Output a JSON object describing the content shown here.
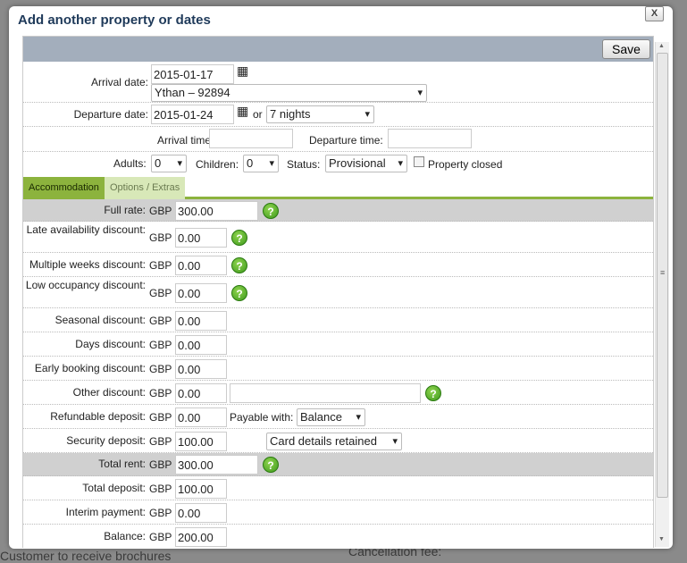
{
  "background": {
    "text1": "Customer to receive brochures",
    "text2": "Cancellation fee:"
  },
  "dialog": {
    "title": "Add another property or dates",
    "close_label": "X",
    "save_label": "Save"
  },
  "booking": {
    "arrival_date_label": "Arrival date:",
    "arrival_date": "2015-01-17",
    "property": "Ythan – 92894",
    "departure_date_label": "Departure date:",
    "departure_date": "2015-01-24",
    "or_label": "or",
    "nights": "7 nights",
    "arrival_time_label": "Arrival time:",
    "arrival_time": "",
    "departure_time_label": "Departure time:",
    "departure_time": "",
    "adults_label": "Adults:",
    "adults": "0",
    "children_label": "Children:",
    "children": "0",
    "status_label": "Status:",
    "status": "Provisional",
    "property_closed_label": "Property closed",
    "property_closed": false
  },
  "tabs": [
    {
      "label": "Accommodation",
      "active": true
    },
    {
      "label": "Options / Extras",
      "active": false
    }
  ],
  "currency": "GBP",
  "fields": [
    {
      "label": "Full rate:",
      "value": "300.00"
    },
    {
      "label": "Late availability discount:",
      "value": "0.00"
    },
    {
      "label": "Multiple weeks discount:",
      "value": "0.00"
    },
    {
      "label": "Low occupancy discount:",
      "value": "0.00"
    },
    {
      "label": "Seasonal discount:",
      "value": "0.00"
    },
    {
      "label": "Days discount:",
      "value": "0.00"
    },
    {
      "label": "Early booking discount:",
      "value": "0.00"
    },
    {
      "label": "Other discount:",
      "value": "0.00",
      "note": ""
    },
    {
      "label": "Refundable deposit:",
      "value": "0.00",
      "payable_label": "Payable with:",
      "payable": "Balance"
    },
    {
      "label": "Security deposit:",
      "value": "100.00",
      "method": "Card details retained"
    },
    {
      "label": "Total rent:",
      "value": "300.00"
    },
    {
      "label": "Total deposit:",
      "value": "100.00"
    },
    {
      "label": "Interim payment:",
      "value": "0.00"
    },
    {
      "label": "Balance:",
      "value": "200.00"
    }
  ],
  "help_icon": "?"
}
